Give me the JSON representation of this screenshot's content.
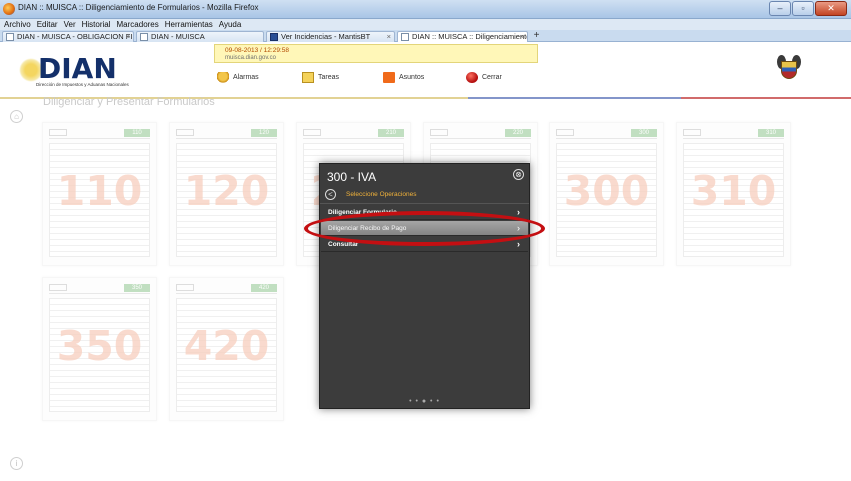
{
  "window": {
    "title": "DIAN :: MUISCA :: Diligenciamiento de Formularios - Mozilla Firefox"
  },
  "menubar": {
    "items": [
      "Archivo",
      "Editar",
      "Ver",
      "Historial",
      "Marcadores",
      "Herramientas",
      "Ayuda"
    ]
  },
  "tabs": [
    {
      "label": "DIAN - MUISCA - OBLIGACION FINA...",
      "active": false
    },
    {
      "label": "DIAN - MUISCA",
      "active": false
    },
    {
      "label": "Ver Incidencias - MantisBT",
      "active": false
    },
    {
      "label": "DIAN :: MUISCA :: Diligenciamiento d...",
      "active": true
    }
  ],
  "header": {
    "logo_text": "DIAN",
    "logo_subtitle": "Dirección de Impuestos y Aduanas Nacionales",
    "datetime": "09-08-2013 / 12:29:58",
    "host": "muisca.dian.gov.co",
    "nav": [
      {
        "label": "Alarmas",
        "icon": "bell-icon"
      },
      {
        "label": "Tareas",
        "icon": "calendar-icon"
      },
      {
        "label": "Asuntos",
        "icon": "folder-icon"
      },
      {
        "label": "Cerrar",
        "icon": "power-icon"
      }
    ]
  },
  "page": {
    "heading": "Diligenciar y Presentar Formularios",
    "forms": [
      {
        "number": "110"
      },
      {
        "number": "120"
      },
      {
        "number": "210"
      },
      {
        "number": "220"
      },
      {
        "number": "300"
      },
      {
        "number": "310"
      },
      {
        "number": "350"
      },
      {
        "number": "420"
      }
    ]
  },
  "modal": {
    "title": "300 - IVA",
    "subtitle": "Seleccione Operaciones",
    "close_glyph": "⊗",
    "back_glyph": "<",
    "items": [
      {
        "label": "Diligenciar Formulario",
        "highlighted": false
      },
      {
        "label": "Diligenciar Recibo de Pago",
        "highlighted": true
      },
      {
        "label": "Consultar",
        "highlighted": false
      }
    ],
    "pager": "• • ● • •"
  },
  "colors": {
    "accent_orange": "#f1b23a",
    "dian_blue": "#14306a",
    "highlight_ring": "#c40f12"
  }
}
